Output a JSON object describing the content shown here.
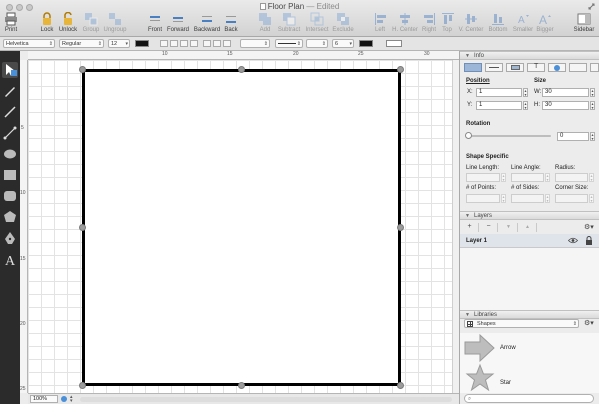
{
  "window": {
    "title": "Floor Plan",
    "edited": "— Edited"
  },
  "toolbar": {
    "print": "Print",
    "lock": "Lock",
    "unlock": "Unlock",
    "group": "Group",
    "ungroup": "Ungroup",
    "front": "Front",
    "forward": "Forward",
    "backward": "Backward",
    "back": "Back",
    "add": "Add",
    "subtract": "Subtract",
    "intersect": "Intersect",
    "exclude": "Exclude",
    "left": "Left",
    "hcenter": "H. Center",
    "right": "Right",
    "top": "Top",
    "vcenter": "V. Center",
    "bottom": "Bottom",
    "smaller": "Smaller",
    "bigger": "Bigger",
    "sidebar": "Sidebar"
  },
  "formatbar": {
    "font": "Helvetica",
    "style": "Regular",
    "size": "12",
    "stroke_width": "6"
  },
  "ruler": {
    "h": [
      "10",
      "15",
      "20",
      "25",
      "30"
    ],
    "v": [
      "5",
      "10",
      "15",
      "20",
      "25"
    ]
  },
  "zoom": "100%",
  "inspector": {
    "header": "Info",
    "position_label": "Position",
    "size_label": "Size",
    "x_label": "X:",
    "x": "1",
    "y_label": "Y:",
    "y": "1",
    "w_label": "W:",
    "w": "30",
    "h_label": "H:",
    "h": "30",
    "rotation_label": "Rotation",
    "rotation": "0",
    "shape_specific": "Shape Specific",
    "line_length": "Line Length:",
    "line_angle": "Line Angle:",
    "radius": "Radius:",
    "num_points": "# of Points:",
    "num_sides": "# of Sides:",
    "corner_size": "Corner Size:"
  },
  "layers": {
    "header": "Layers",
    "items": [
      {
        "name": "Layer 1"
      }
    ]
  },
  "libraries": {
    "header": "Libraries",
    "selected": "Shapes",
    "items": [
      {
        "name": "Arrow"
      },
      {
        "name": "Star"
      }
    ]
  },
  "colors": {
    "selection": "#9cb6d8",
    "stroke": "#000000",
    "tools_bg": "#2b2b2b",
    "tool_accent": "#4a90d9"
  }
}
